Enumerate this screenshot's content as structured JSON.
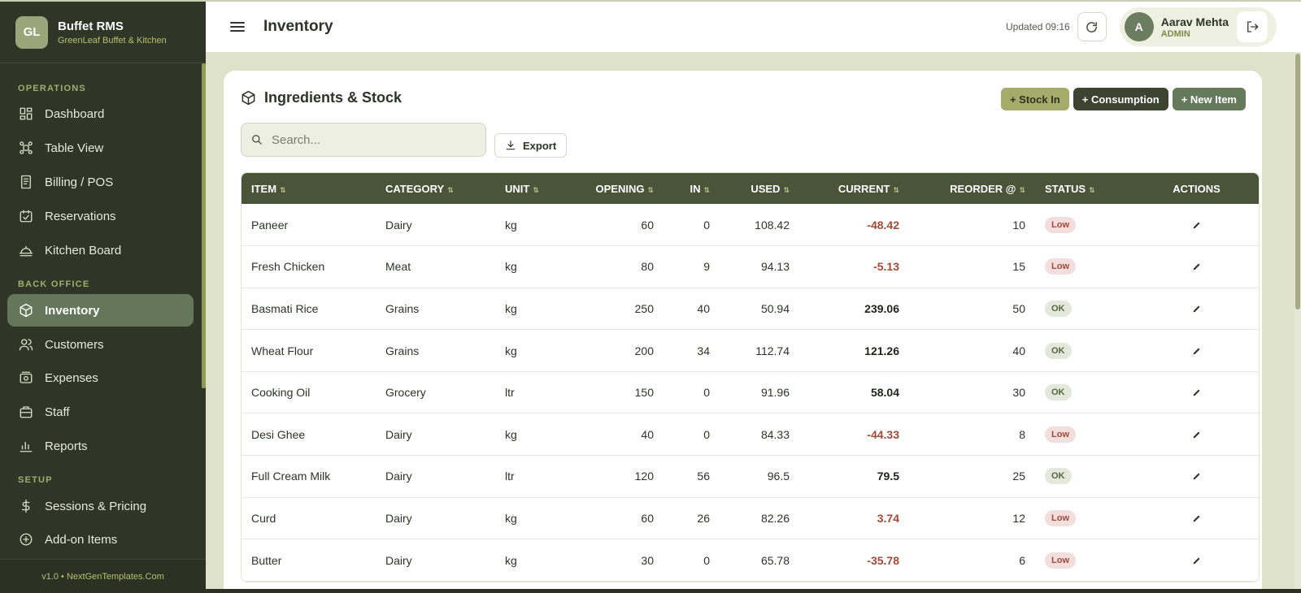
{
  "brand": {
    "initials": "GL",
    "title": "Buffet RMS",
    "subtitle": "GreenLeaf Buffet & Kitchen"
  },
  "sidebar": {
    "sections": [
      {
        "label": "OPERATIONS"
      },
      {
        "label": "BACK OFFICE"
      },
      {
        "label": "SETUP"
      }
    ],
    "items": [
      {
        "label": "Dashboard",
        "icon": "dashboard-icon"
      },
      {
        "label": "Table View",
        "icon": "table-view-icon"
      },
      {
        "label": "Billing / POS",
        "icon": "receipt-icon"
      },
      {
        "label": "Reservations",
        "icon": "calendar-check-icon"
      },
      {
        "label": "Kitchen Board",
        "icon": "cloche-icon"
      },
      {
        "label": "Inventory",
        "icon": "box-icon",
        "active": true
      },
      {
        "label": "Customers",
        "icon": "users-icon"
      },
      {
        "label": "Expenses",
        "icon": "wallet-icon"
      },
      {
        "label": "Staff",
        "icon": "briefcase-icon"
      },
      {
        "label": "Reports",
        "icon": "bar-chart-icon"
      },
      {
        "label": "Sessions & Pricing",
        "icon": "dollar-icon"
      },
      {
        "label": "Add-on Items",
        "icon": "plus-circle-icon"
      }
    ],
    "footer": "v1.0 • NextGenTemplates.Com"
  },
  "header": {
    "title": "Inventory",
    "updated": "Updated 09:16",
    "user": {
      "initial": "A",
      "name": "Aarav Mehta",
      "role": "ADMIN"
    }
  },
  "card": {
    "title": "Ingredients & Stock",
    "buttons": {
      "stock_in": "+ Stock In",
      "consumption": "+ Consumption",
      "new_item": "+ New Item"
    },
    "search_placeholder": "Search...",
    "export_label": "Export"
  },
  "table": {
    "columns": [
      "ITEM",
      "CATEGORY",
      "UNIT",
      "OPENING",
      "IN",
      "USED",
      "CURRENT",
      "REORDER @",
      "STATUS",
      "ACTIONS"
    ],
    "sort_glyph": "⇅",
    "rows": [
      {
        "item": "Paneer",
        "category": "Dairy",
        "unit": "kg",
        "opening": "60",
        "in": "0",
        "used": "108.42",
        "current": "-48.42",
        "reorder": "10",
        "status": "Low"
      },
      {
        "item": "Fresh Chicken",
        "category": "Meat",
        "unit": "kg",
        "opening": "80",
        "in": "9",
        "used": "94.13",
        "current": "-5.13",
        "reorder": "15",
        "status": "Low"
      },
      {
        "item": "Basmati Rice",
        "category": "Grains",
        "unit": "kg",
        "opening": "250",
        "in": "40",
        "used": "50.94",
        "current": "239.06",
        "reorder": "50",
        "status": "OK"
      },
      {
        "item": "Wheat Flour",
        "category": "Grains",
        "unit": "kg",
        "opening": "200",
        "in": "34",
        "used": "112.74",
        "current": "121.26",
        "reorder": "40",
        "status": "OK"
      },
      {
        "item": "Cooking Oil",
        "category": "Grocery",
        "unit": "ltr",
        "opening": "150",
        "in": "0",
        "used": "91.96",
        "current": "58.04",
        "reorder": "30",
        "status": "OK"
      },
      {
        "item": "Desi Ghee",
        "category": "Dairy",
        "unit": "kg",
        "opening": "40",
        "in": "0",
        "used": "84.33",
        "current": "-44.33",
        "reorder": "8",
        "status": "Low"
      },
      {
        "item": "Full Cream Milk",
        "category": "Dairy",
        "unit": "ltr",
        "opening": "120",
        "in": "56",
        "used": "96.5",
        "current": "79.5",
        "reorder": "25",
        "status": "OK"
      },
      {
        "item": "Curd",
        "category": "Dairy",
        "unit": "kg",
        "opening": "60",
        "in": "26",
        "used": "82.26",
        "current": "3.74",
        "reorder": "12",
        "status": "Low"
      },
      {
        "item": "Butter",
        "category": "Dairy",
        "unit": "kg",
        "opening": "30",
        "in": "0",
        "used": "65.78",
        "current": "-35.78",
        "reorder": "6",
        "status": "Low"
      }
    ]
  },
  "colors": {
    "sidebar_bg": "#2f3627",
    "accent": "#65775a",
    "header_row": "#4a5439",
    "low": "#a24a36",
    "ok": "#556648"
  }
}
